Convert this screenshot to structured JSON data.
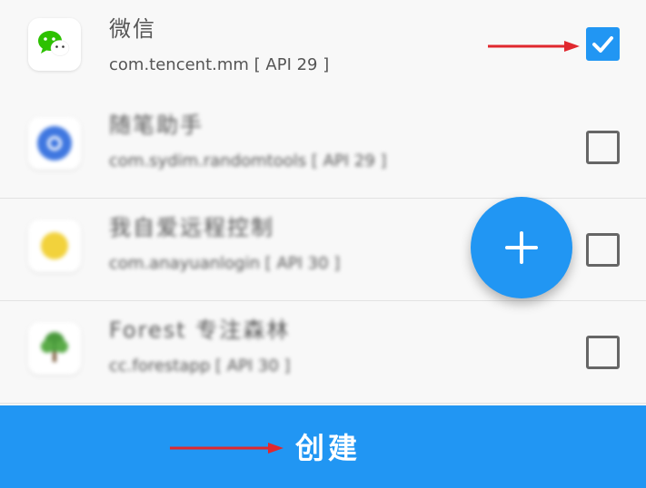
{
  "apps": [
    {
      "name": "微信",
      "package": "com.tencent.mm [ API 29 ]",
      "checked": true,
      "icon": "wechat-icon"
    },
    {
      "name": "随笔助手",
      "package": "com.sydim.randomtools [ API 29 ]",
      "checked": false,
      "icon": "blue-circle-app-icon"
    },
    {
      "name": "我自爱远程控制",
      "package": "com.anayuanlogin [ API 30 ]",
      "checked": false,
      "icon": "yellow-sun-app-icon"
    },
    {
      "name": "Forest 专注森林",
      "package": "cc.forestapp [ API 30 ]",
      "checked": false,
      "icon": "tree-icon"
    }
  ],
  "fab": {
    "icon": "plus-icon",
    "symbol": "+"
  },
  "create_button": {
    "label": "创建"
  },
  "colors": {
    "accent": "#2196F3",
    "annotation_arrow": "#E0282E"
  }
}
